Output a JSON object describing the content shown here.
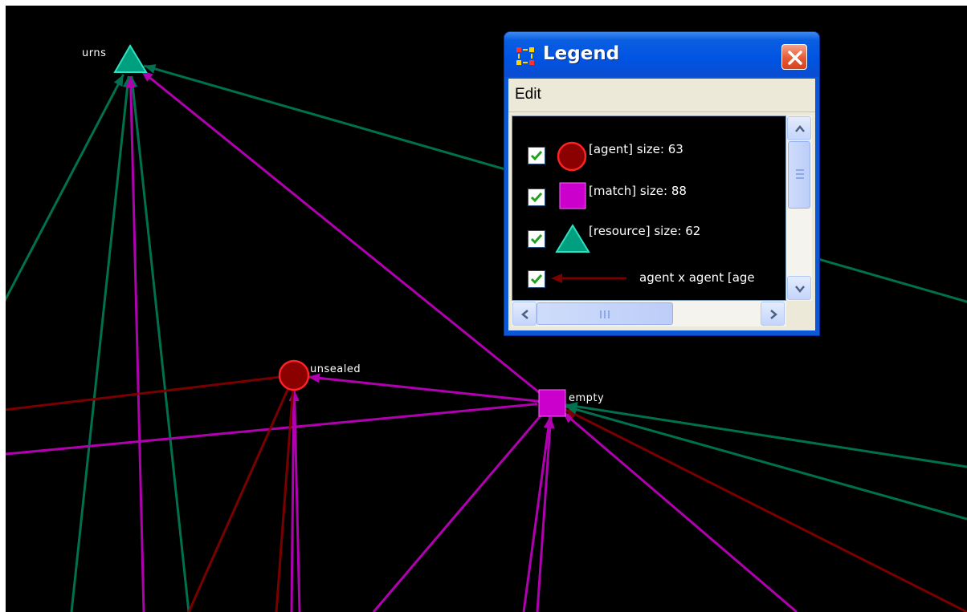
{
  "network": {
    "nodes": {
      "urns": {
        "label": "urns",
        "type": "resource"
      },
      "unsealed": {
        "label": "unsealed",
        "type": "agent"
      },
      "empty": {
        "label": "empty",
        "type": "match"
      }
    },
    "colors": {
      "background": "#000000",
      "agent_fill": "#8b0000",
      "agent_stroke": "#ff2222",
      "match_fill": "#cc00cc",
      "resource_fill": "#009f80",
      "resource_stroke": "#30e0c0",
      "edge_resource": "#00704f",
      "edge_match": "#b000b0",
      "edge_agent": "#7a0000"
    }
  },
  "legend_window": {
    "title": "Legend",
    "menu": {
      "edit": "Edit"
    },
    "entries": [
      {
        "label": "[agent] size: 63",
        "checked": true,
        "shape": "circle"
      },
      {
        "label": "[match] size: 88",
        "checked": true,
        "shape": "square"
      },
      {
        "label": "[resource] size: 62",
        "checked": true,
        "shape": "triangle"
      },
      {
        "label": "agent x agent [age",
        "checked": true,
        "shape": "arrow"
      }
    ]
  }
}
